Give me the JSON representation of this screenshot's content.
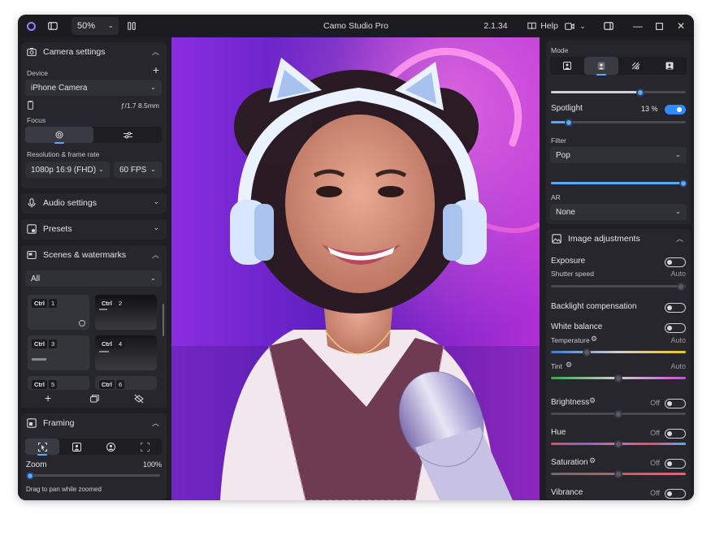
{
  "app": {
    "title": "Camo Studio Pro",
    "version": "2.1.34",
    "zoom": "50%",
    "help_label": "Help"
  },
  "camera": {
    "header": "Camera settings",
    "device_label": "Device",
    "device_value": "iPhone Camera",
    "lens_info": "ƒ/1.7 8.5mm",
    "focus_label": "Focus",
    "resolution_label": "Resolution & frame rate",
    "resolution_value": "1080p 16:9 (FHD)",
    "fps_value": "60 FPS"
  },
  "audio": {
    "header": "Audio settings"
  },
  "presets": {
    "header": "Presets"
  },
  "scenes": {
    "header": "Scenes & watermarks",
    "filter_value": "All",
    "items": [
      {
        "ctrl": "Ctrl",
        "num": "1"
      },
      {
        "ctrl": "Ctrl",
        "num": "2"
      },
      {
        "ctrl": "Ctrl",
        "num": "3"
      },
      {
        "ctrl": "Ctrl",
        "num": "4"
      },
      {
        "ctrl": "Ctrl",
        "num": "5"
      },
      {
        "ctrl": "Ctrl",
        "num": "6"
      }
    ]
  },
  "framing": {
    "header": "Framing",
    "zoom_label": "Zoom",
    "zoom_value": "100%",
    "hint": "Drag to pan while zoomed"
  },
  "mode": {
    "label": "Mode",
    "slider_level": 0.66,
    "spotlight_label": "Spotlight",
    "spotlight_value": "13 %",
    "spotlight_level": 0.13,
    "filter_label": "Filter",
    "filter_value": "Pop",
    "filter_level": 0.98,
    "ar_label": "AR",
    "ar_value": "None"
  },
  "image_adjustments": {
    "header": "Image adjustments",
    "exposure_label": "Exposure",
    "shutter_label": "Shutter speed",
    "shutter_value": "Auto",
    "backlight_label": "Backlight compensation",
    "white_balance_label": "White balance",
    "temperature_label": "Temperature",
    "temperature_value": "Auto",
    "tint_label": "Tint",
    "tint_value": "Auto",
    "brightness_label": "Brightness",
    "brightness_value": "Off",
    "hue_label": "Hue",
    "hue_value": "Off",
    "saturation_label": "Saturation",
    "saturation_value": "Off",
    "vibrance_label": "Vibrance",
    "vibrance_value": "Off"
  },
  "colors": {
    "accent": "#2d8cff",
    "logo": "#9b7cff",
    "background": "#1e1e23"
  }
}
